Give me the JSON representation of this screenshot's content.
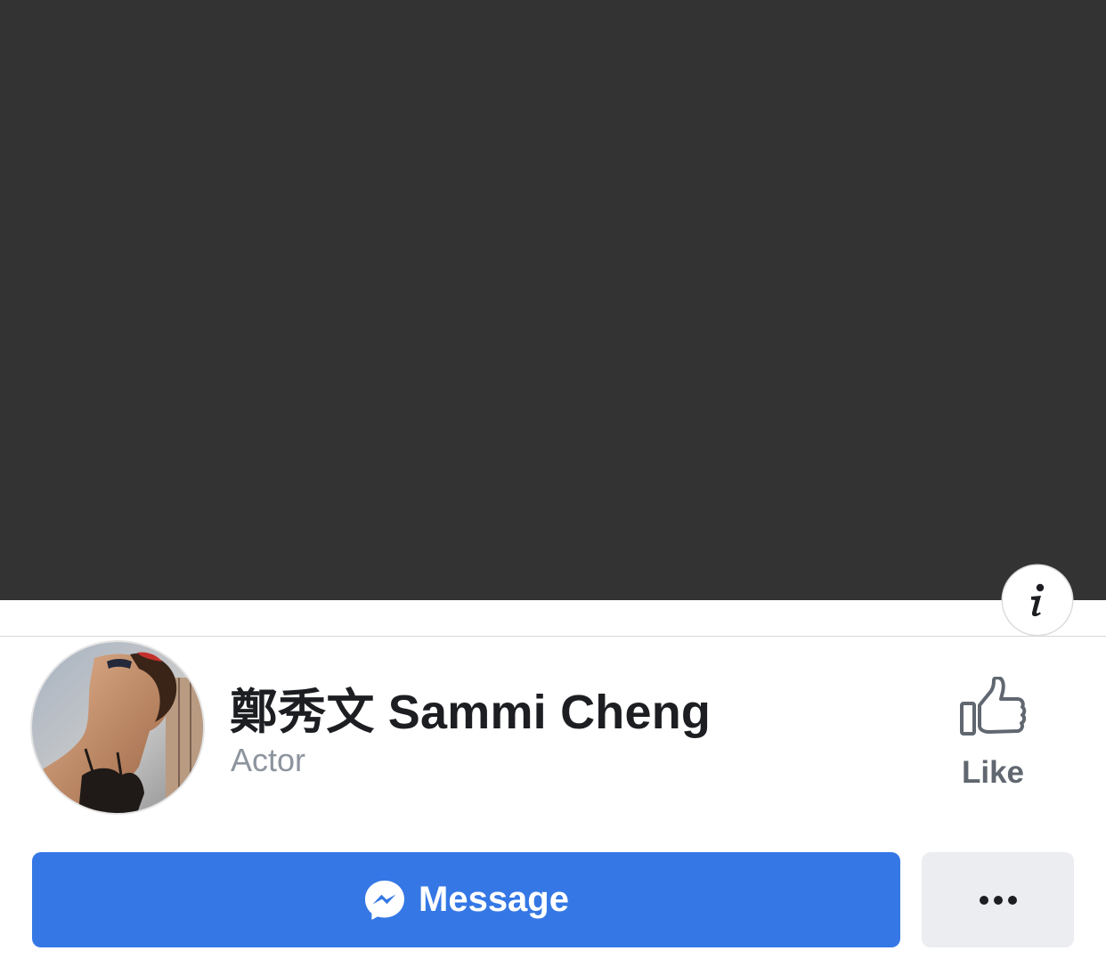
{
  "profile": {
    "name": "鄭秀文 Sammi Cheng",
    "category": "Actor"
  },
  "actions": {
    "like_label": "Like",
    "message_label": "Message"
  },
  "icons": {
    "info": "info-icon",
    "like": "thumbs-up-icon",
    "messenger": "messenger-icon",
    "more": "more-dots-icon"
  },
  "colors": {
    "cover": "#333333",
    "primary": "#3578e5",
    "secondary_button": "#ebedf0",
    "title_text": "#1c1e21",
    "muted_text": "#8d949e",
    "icon_gray": "#606770"
  }
}
